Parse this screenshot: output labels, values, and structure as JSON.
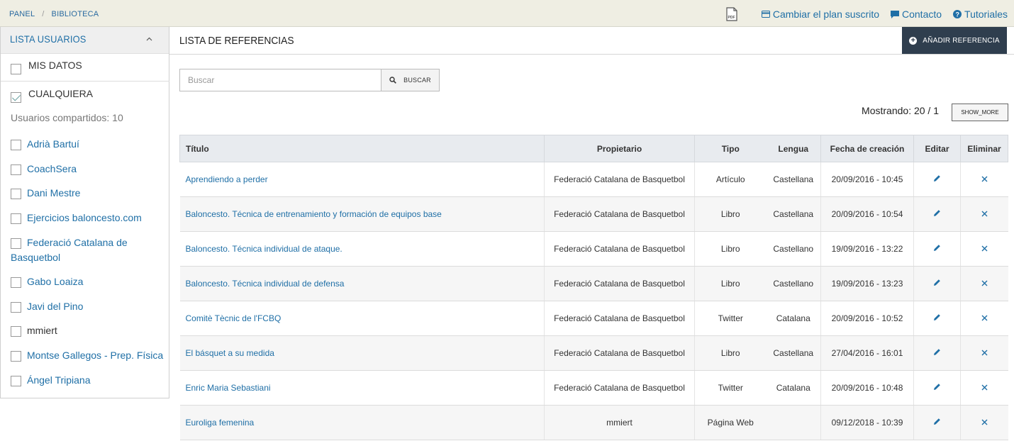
{
  "breadcrumb": [
    "PANEL",
    "BIBLIOTECA"
  ],
  "top_links": [
    {
      "label": "Cambiar el plan suscrito",
      "icon": "credit-card-icon"
    },
    {
      "label": "Contacto",
      "icon": "chat-icon"
    },
    {
      "label": "Tutoriales",
      "icon": "help-circle-icon"
    }
  ],
  "pdf_icon": "pdf-file-icon",
  "sidebar": {
    "title": "LISTA USUARIOS",
    "my_data": "MIS DATOS",
    "any": "CUALQUIERA",
    "shared_label": "Usuarios compartidos: 10",
    "users": [
      "Adrià Bartuí",
      "CoachSera",
      "Dani Mestre",
      "Ejercicios baloncesto.com",
      "Federació Catalana de Basquetbol",
      "Gabo Loaiza",
      "Javi del Pino",
      "mmiert",
      "Montse Gallegos - Prep. Física",
      "Ángel Tripiana"
    ]
  },
  "main": {
    "title": "LISTA DE REFERENCIAS",
    "add_button": "AÑADIR REFERENCIA",
    "search_placeholder": "Buscar",
    "search_button": "BUSCAR",
    "showing": "Mostrando: 20 / 1",
    "show_more": "SHOW_MORE"
  },
  "table": {
    "headers": [
      "Título",
      "Propietario",
      "Tipo",
      "Lengua",
      "Fecha de creación",
      "Editar",
      "Eliminar"
    ],
    "rows": [
      [
        "Aprendiendo a perder",
        "Federació Catalana de Basquetbol",
        "Artículo",
        "Castellana",
        "20/09/2016 - 10:45"
      ],
      [
        "Baloncesto. Técnica de entrenamiento y formación de equipos base",
        "Federació Catalana de Basquetbol",
        "Libro",
        "Castellana",
        "20/09/2016 - 10:54"
      ],
      [
        "Baloncesto. Técnica individual de ataque.",
        "Federació Catalana de Basquetbol",
        "Libro",
        "Castellano",
        "19/09/2016 - 13:22"
      ],
      [
        "Baloncesto. Técnica individual de defensa",
        "Federació Catalana de Basquetbol",
        "Libro",
        "Castellano",
        "19/09/2016 - 13:23"
      ],
      [
        "Comitè Tècnic de l'FCBQ",
        "Federació Catalana de Basquetbol",
        "Twitter",
        "Catalana",
        "20/09/2016 - 10:52"
      ],
      [
        "El básquet a su medida",
        "Federació Catalana de Basquetbol",
        "Libro",
        "Castellana",
        "27/04/2016 - 16:01"
      ],
      [
        "Enric Maria Sebastiani",
        "Federació Catalana de Basquetbol",
        "Twitter",
        "Catalana",
        "20/09/2016 - 10:48"
      ],
      [
        "Euroliga femenina",
        "mmiert",
        "Página Web",
        "",
        "09/12/2018 - 10:39"
      ]
    ]
  },
  "colors": {
    "link": "#1f6fa6",
    "topbar": "#efeee3",
    "add_button_bg": "#2f3e4e"
  }
}
